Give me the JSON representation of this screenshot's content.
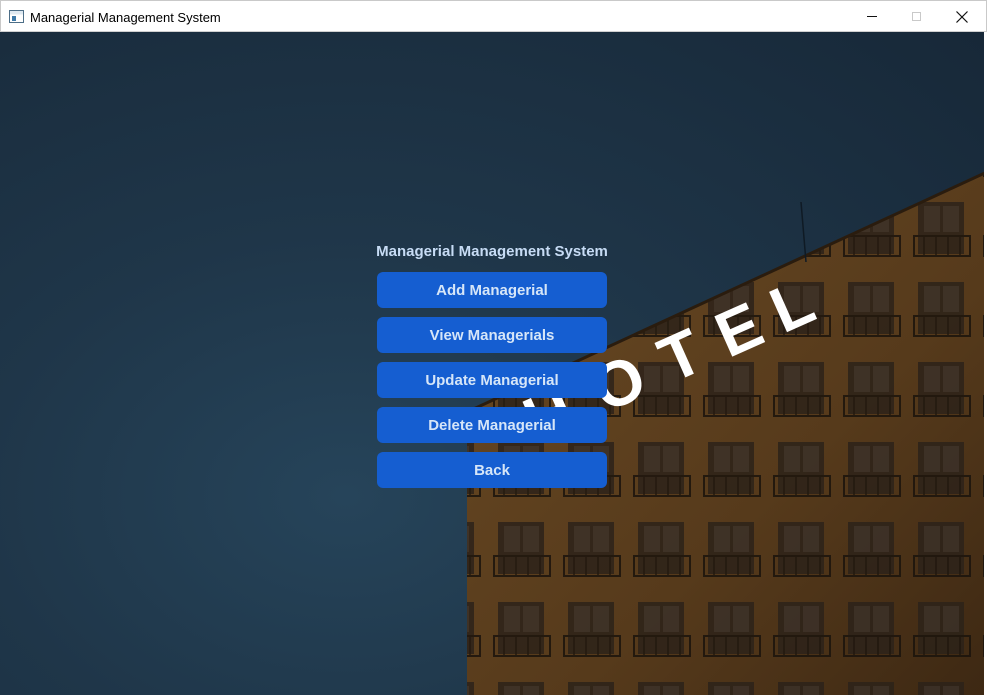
{
  "window": {
    "title": "Managerial Management System",
    "icon": "app-window-icon",
    "controls": [
      "minimize-icon",
      "maximize-icon",
      "close-icon"
    ]
  },
  "background": {
    "sign_text": "OTEL",
    "colors": {
      "sky": "#1f3649",
      "building": "#5a3f1f",
      "sign": "#ffffff"
    }
  },
  "menu": {
    "title": "Managerial Management System",
    "buttons": [
      {
        "label": "Add Managerial"
      },
      {
        "label": "View Managerials"
      },
      {
        "label": "Update Managerial"
      },
      {
        "label": "Delete Managerial"
      },
      {
        "label": "Back"
      }
    ],
    "colors": {
      "button_bg": "#155ed1",
      "button_text": "#d6e6f8",
      "title_text": "#c7dcf5"
    }
  }
}
